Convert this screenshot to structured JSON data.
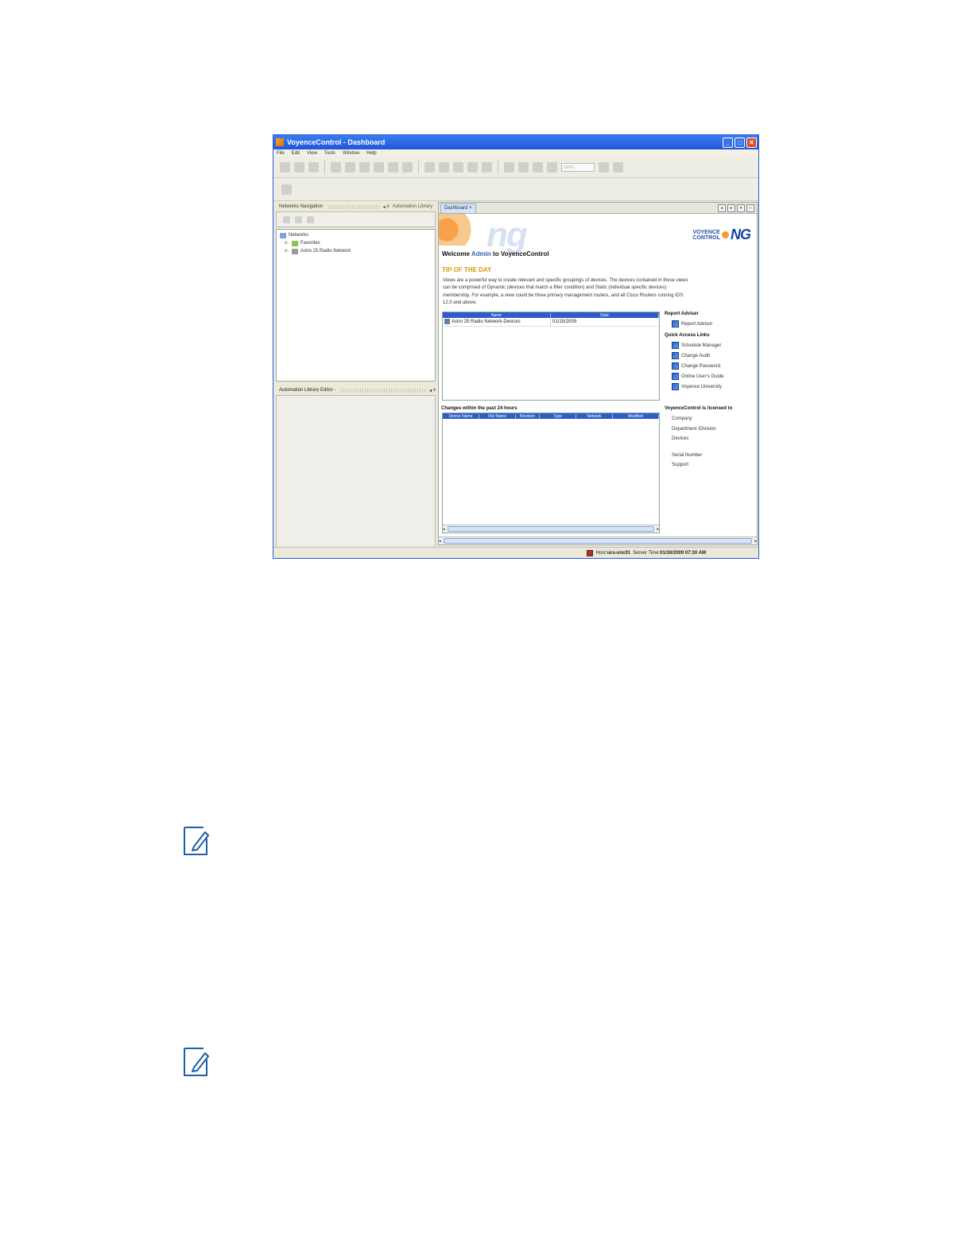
{
  "window": {
    "title": "VoyenceControl - Dashboard"
  },
  "menu": [
    "File",
    "Edit",
    "View",
    "Tools",
    "Window",
    "Help"
  ],
  "toolbar": {
    "zoom": "100%"
  },
  "left_panel": {
    "tabs": [
      "Networks Navigation",
      "Automation Library"
    ],
    "tree": [
      {
        "label": "Networks",
        "level": 0
      },
      {
        "label": "Favorites",
        "level": 1
      },
      {
        "label": "Astro 25 Radio Network",
        "level": 1
      }
    ],
    "editor_title": "Automation Library Editor -"
  },
  "main": {
    "tab": "Dashboard",
    "logo": {
      "line1": "VOYENCE",
      "line2": "CONTROL",
      "mark": "NG"
    },
    "welcome": {
      "prefix": "Welcome",
      "user": "Admin",
      "suffix": "to VoyenceControl"
    },
    "tip_title": "TIP OF THE DAY",
    "tip_text": "Views are a powerful way to create relevant and specific groupings of devices.  The devices contained in these views can be comprised of Dynamic (devices that match a filter condition) and Static (individual specific devices) membership.  For example, a view could be three primary management routers, and all Cisco Routers running IOS 12.0 and above.",
    "views_table": {
      "columns": [
        "Name",
        "Date"
      ],
      "rows": [
        {
          "name": "Astro 25 Radio Network-Devices",
          "date": "01/15/2009"
        }
      ]
    },
    "report_adviser": {
      "title": "Report Adviser",
      "items": [
        "Report Advisor"
      ]
    },
    "quick_links": {
      "title": "Quick Access Links",
      "items": [
        "Schedule Manager",
        "Change Audit",
        "Change Password",
        "Online User's Guide",
        "Voyence University"
      ]
    },
    "changes": {
      "title": "Changes within the past 24 hours",
      "columns": [
        "Device Name",
        "File Name",
        "Revision",
        "Type",
        "Network",
        "Modified"
      ]
    },
    "license": {
      "title": "VoyenceControl is licensed to",
      "fields": [
        "Company",
        "Department /Division",
        "Devices",
        "Serial Number",
        "Support"
      ]
    }
  },
  "status": {
    "host_label": "Host:",
    "host": "ucs-unc01",
    "time_label": "Server Time:",
    "time": "01/30/2009 07:30 AM"
  },
  "colors": {
    "accent": "#2f5cc8",
    "tip": "#d39b0f",
    "titlebar": "#1f56d6"
  },
  "icons": {
    "note": "edit-note-icon"
  }
}
